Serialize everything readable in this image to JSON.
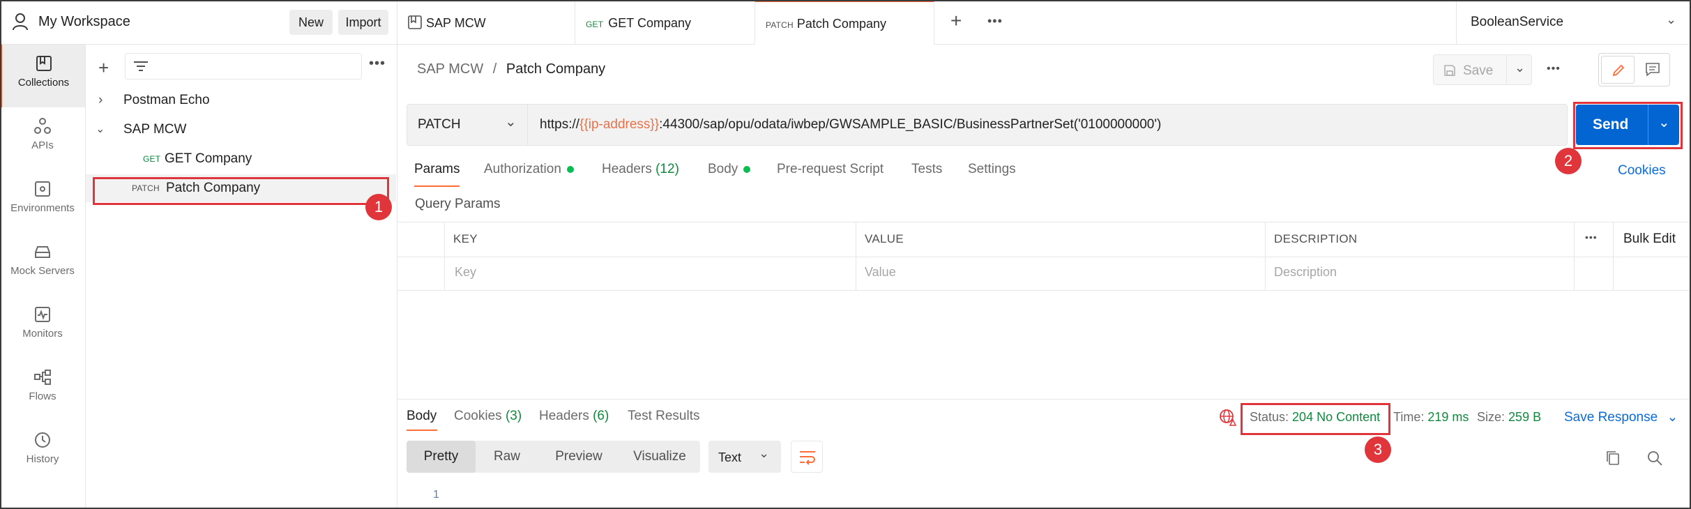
{
  "workspace": {
    "title": "My Workspace",
    "new_label": "New",
    "import_label": "Import"
  },
  "rail": [
    {
      "label": "Collections",
      "icon": "collections-icon"
    },
    {
      "label": "APIs",
      "icon": "apis-icon"
    },
    {
      "label": "Environments",
      "icon": "environments-icon"
    },
    {
      "label": "Mock Servers",
      "icon": "mock-servers-icon"
    },
    {
      "label": "Monitors",
      "icon": "monitors-icon"
    },
    {
      "label": "Flows",
      "icon": "flows-icon"
    },
    {
      "label": "History",
      "icon": "history-icon"
    }
  ],
  "collections": {
    "items": [
      {
        "label": "Postman Echo"
      },
      {
        "label": "SAP MCW"
      }
    ],
    "requests": [
      {
        "method": "GET",
        "label": "GET Company"
      },
      {
        "method": "PATCH",
        "label": "Patch Company"
      }
    ]
  },
  "tabs": [
    {
      "method": "",
      "label": "SAP MCW"
    },
    {
      "method": "GET",
      "label": "GET Company"
    },
    {
      "method": "PATCH",
      "label": "Patch Company"
    }
  ],
  "environment": {
    "selected": "BooleanService"
  },
  "breadcrumb": {
    "parent": "SAP MCW",
    "separator": "/",
    "current": "Patch Company"
  },
  "toolbar": {
    "save_label": "Save"
  },
  "request": {
    "method": "PATCH",
    "url_prefix": "https://",
    "url_variable": "{{ip-address}}",
    "url_suffix": ":44300/sap/opu/odata/iwbep/GWSAMPLE_BASIC/BusinessPartnerSet('0100000000')",
    "send_label": "Send"
  },
  "request_tabs": {
    "params": "Params",
    "authorization": "Authorization",
    "headers": "Headers",
    "headers_count": "(12)",
    "body": "Body",
    "prerequest": "Pre-request Script",
    "tests": "Tests",
    "settings": "Settings",
    "cookies": "Cookies"
  },
  "query_params": {
    "title": "Query Params",
    "columns": [
      "KEY",
      "VALUE",
      "DESCRIPTION"
    ],
    "placeholders": [
      "Key",
      "Value",
      "Description"
    ],
    "bulk_edit": "Bulk Edit"
  },
  "response": {
    "tabs": {
      "body": "Body",
      "cookies": "Cookies",
      "cookies_count": "(3)",
      "headers": "Headers",
      "headers_count": "(6)",
      "test_results": "Test Results"
    },
    "status_label": "Status:",
    "status_value": "204 No Content",
    "time_label": "Time:",
    "time_value": "219 ms",
    "size_label": "Size:",
    "size_value": "259 B",
    "save_response": "Save Response",
    "views": [
      "Pretty",
      "Raw",
      "Preview",
      "Visualize"
    ],
    "format": "Text",
    "line_number": "1"
  },
  "callouts": [
    "1",
    "2",
    "3"
  ],
  "colors": {
    "accent": "#ff6c37",
    "send": "#0265d2",
    "callout": "#e0363b",
    "status_ok": "#0f8a3d",
    "variable": "#e8734a"
  }
}
